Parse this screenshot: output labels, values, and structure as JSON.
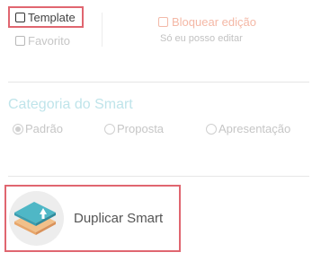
{
  "options": {
    "template_label": "Template",
    "favorito_label": "Favorito",
    "bloquear_label": "Bloquear edição",
    "bloquear_hint": "Só eu posso editar"
  },
  "categoria": {
    "title": "Categoria do Smart",
    "options": [
      {
        "label": "Padrão",
        "selected": true
      },
      {
        "label": "Proposta",
        "selected": false
      },
      {
        "label": "Apresentação",
        "selected": false
      }
    ]
  },
  "duplicate": {
    "label": "Duplicar Smart",
    "icon": "duplicate-layers-icon"
  },
  "colors": {
    "highlight_border": "#e06670",
    "category_title": "#bfe4ea",
    "bloquear_text": "#f4b8a6",
    "icon_teal": "#4fb7c6",
    "icon_orange": "#f1c08a"
  }
}
